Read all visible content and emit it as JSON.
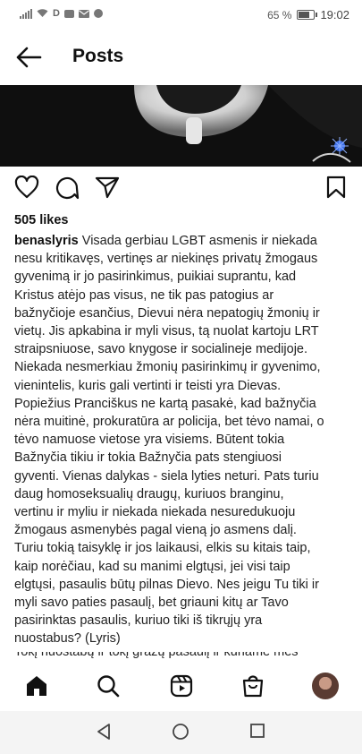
{
  "status_bar": {
    "left_icons": [
      "signal-icon",
      "wifi-icon",
      "d-indicator",
      "square-notification-icon",
      "mail-icon",
      "messenger-icon"
    ],
    "d_label": "D",
    "battery_text": "65 %",
    "battery_level": 0.65,
    "time": "19:02"
  },
  "header": {
    "title": "Posts",
    "back_icon": "arrow-left-icon"
  },
  "post": {
    "likes": "505 likes",
    "username": "benaslyris",
    "caption_lines": [
      "Visada gerbiau LGBT asmenis ir niekada",
      "nesu kritikavęs, vertinęs ar niekinęs privatų žmogaus",
      "gyvenimą ir jo pasirinkimus, puikiai suprantu, kad",
      "Kristus atėjo pas visus, ne tik pas patogius ar",
      "bažnyčioje esančius, Dievui nėra nepatogių žmonių ir",
      "vietų. Jis apkabina ir myli visus, tą nuolat kartoju LRT",
      "straipsniuose, savo knygose ir socialineje medijoje.",
      "Niekada nesmerkiau žmonių pasirinkimų ir gyvenimo,",
      "vienintelis, kuris gali vertinti ir teisti yra Dievas.",
      "Popiežius Pranciškus ne kartą pasakė, kad bažnyčia",
      "nėra muitinė, prokuratūra ar policija, bet tėvo namai, o",
      "tėvo namuose vietose yra visiems. Būtent tokia",
      "Bažnyčia tikiu ir tokia Bažnyčia pats stengiuosi",
      "gyventi. Vienas dalykas - siela lyties neturi. Pats turiu",
      "daug homoseksualių draugų, kuriuos branginu,",
      "vertinu ir myliu ir niekada niekada nesuredukuoju",
      "žmogaus asmenybės pagal vieną jo asmens dalį.",
      "Turiu tokią taisyklę ir jos laikausi, elkis su kitais taip,",
      "kaip norėčiau, kad su manimi elgtųsi, jei visi taip",
      "elgtųsi, pasaulis būtų pilnas Dievo. Nes jeigu Tu tiki ir",
      "myli savo paties pasaulį, bet griauni kitų ar Tavo",
      "pasirinktas pasaulis,  kuriuo tiki iš tikrųjų yra",
      "nuostabus? (Lyris)"
    ],
    "cut_off_line": "Tokį nuostabų ir tokį gražų pasaulį ir kuriame mes",
    "actions": [
      "heart-icon",
      "comment-icon",
      "share-icon",
      "bookmark-icon"
    ]
  },
  "bottom_nav": [
    "home-icon",
    "search-icon",
    "reels-icon",
    "shop-icon",
    "profile-avatar"
  ],
  "system_nav": [
    "back-triangle-icon",
    "home-circle-icon",
    "recents-square-icon"
  ],
  "colors": {
    "text": "#111111",
    "photo_bg": "#101010",
    "sysnav_bg": "#f4f4f4"
  }
}
